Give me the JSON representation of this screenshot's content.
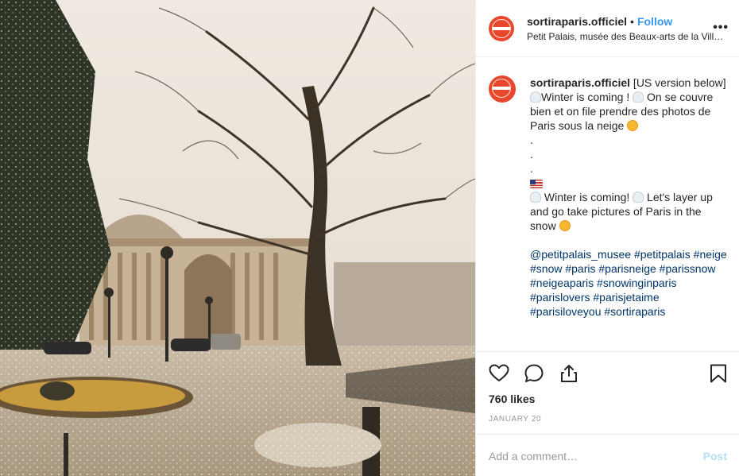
{
  "header": {
    "username": "sortiraparis.officiel",
    "separator": "•",
    "follow_label": "Follow",
    "location": "Petit Palais, musée des Beaux-arts de la Ville de Paris",
    "more_label": "•••"
  },
  "caption": {
    "username": "sortiraparis.officiel",
    "text_first": " [US version below]",
    "line_fr_a": "Winter is coming ! ",
    "line_fr_b": " On se couvre bien et on file prendre des photos de Paris sous la neige ",
    "dots": ".\n.\n.",
    "line_en_a": " Winter is coming! ",
    "line_en_b": " Let's layer up and go take pictures of Paris in the snow ",
    "hashtags": "@petitpalais_musee #petitpalais #neige #snow #paris #parisneige #parissnow #neigeaparis #snowinginparis #parislovers #parisjetaime #parisiloveyou #sortiraparis"
  },
  "emojis": {
    "cloud": "cloud-with-snow-emoji",
    "face": "face-with-tongue-emoji",
    "flag": "us-flag-emoji"
  },
  "actions": {
    "like_icon": "heart-icon",
    "comment_icon": "comment-bubble-icon",
    "share_icon": "share-icon",
    "save_icon": "bookmark-icon",
    "likes": "760 likes",
    "date": "JANUARY 20"
  },
  "comment_box": {
    "placeholder": "Add a comment…",
    "post_label": "Post"
  },
  "colors": {
    "brand_avatar": "#e8472c",
    "link_blue": "#3897f0",
    "hashtag": "#003569",
    "post_disabled": "#b2dffc"
  }
}
